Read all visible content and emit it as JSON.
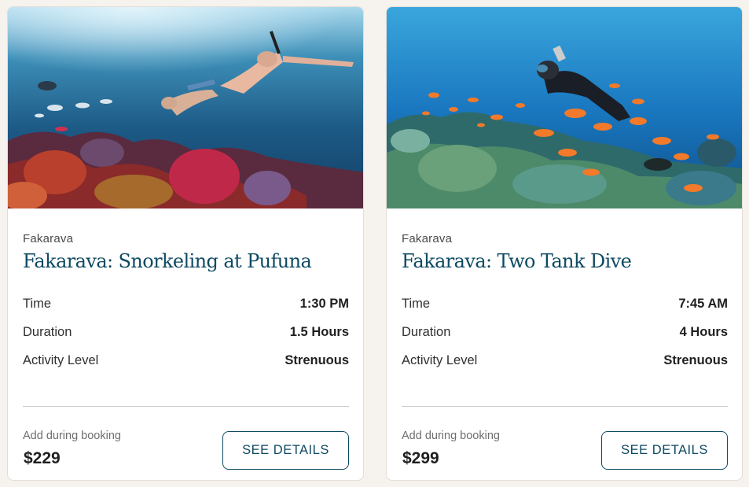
{
  "cards": [
    {
      "location": "Fakarava",
      "title": "Fakarava: Snorkeling at Pufuna",
      "details": [
        {
          "label": "Time",
          "value": "1:30 PM"
        },
        {
          "label": "Duration",
          "value": "1.5 Hours"
        },
        {
          "label": "Activity Level",
          "value": "Strenuous"
        }
      ],
      "add_note": "Add during booking",
      "price": "$229",
      "button_label": "SEE DETAILS",
      "image_alt": "snorkelers above coral reef"
    },
    {
      "location": "Fakarava",
      "title": "Fakarava: Two Tank Dive",
      "details": [
        {
          "label": "Time",
          "value": "7:45 AM"
        },
        {
          "label": "Duration",
          "value": "4 Hours"
        },
        {
          "label": "Activity Level",
          "value": "Strenuous"
        }
      ],
      "add_note": "Add during booking",
      "price": "$299",
      "button_label": "SEE DETAILS",
      "image_alt": "scuba diver with orange reef fish"
    }
  ],
  "colors": {
    "title": "#0e4a62",
    "button_border": "#0e4a62",
    "page_background": "#f6f2ee"
  }
}
